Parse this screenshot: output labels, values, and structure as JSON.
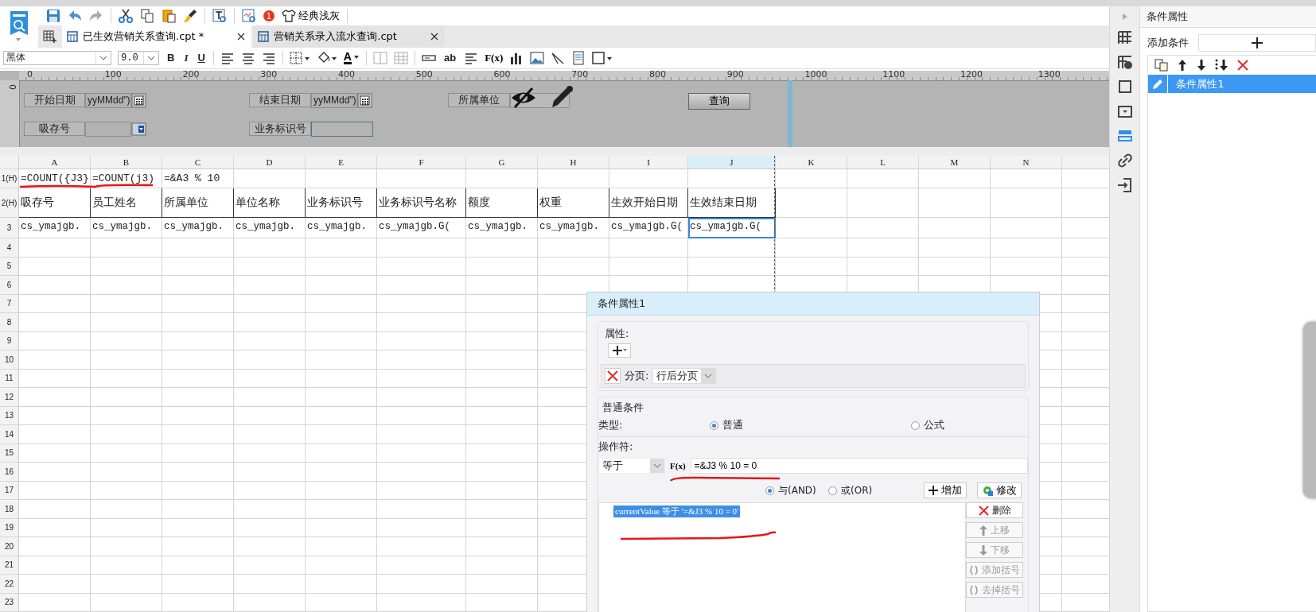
{
  "toolbar": {
    "notification_count": "1",
    "theme_label": "经典浅灰"
  },
  "tabs": [
    {
      "label": "已生效营销关系查询.cpt *",
      "selected": true
    },
    {
      "label": "营销关系录入流水查询.cpt",
      "selected": false
    }
  ],
  "format_bar": {
    "font": "黑体",
    "font_size": "9.0",
    "style_buttons": [
      "B",
      "I",
      "U"
    ],
    "font_color_button": "A",
    "text_button": "ab",
    "formula_button": "F(x)"
  },
  "ruler": {
    "marks": [
      "0",
      "100",
      "200",
      "300",
      "400",
      "500",
      "600",
      "700",
      "800",
      "900",
      "1000",
      "1100",
      "1200",
      "1300"
    ],
    "vertical_mark": "0"
  },
  "parameter_form": {
    "widgets": [
      {
        "kind": "label",
        "text": "开始日期"
      },
      {
        "kind": "date",
        "value": "yyMMdd\")"
      },
      {
        "kind": "label",
        "text": "结束日期"
      },
      {
        "kind": "date",
        "value": "yyMMdd\")"
      },
      {
        "kind": "label",
        "text": "所属单位"
      },
      {
        "kind": "combo",
        "hidden": true
      },
      {
        "kind": "button",
        "text": "查询"
      },
      {
        "kind": "label",
        "text": "吸存号"
      },
      {
        "kind": "combo",
        "hidden": false
      },
      {
        "kind": "label",
        "text": "业务标识号"
      },
      {
        "kind": "text"
      }
    ]
  },
  "sheet": {
    "columns": [
      {
        "label": "A",
        "selected": false
      },
      {
        "label": "B",
        "selected": false
      },
      {
        "label": "C",
        "selected": false
      },
      {
        "label": "D",
        "selected": false
      },
      {
        "label": "E",
        "selected": false
      },
      {
        "label": "F",
        "selected": false
      },
      {
        "label": "G",
        "selected": false
      },
      {
        "label": "H",
        "selected": false
      },
      {
        "label": "I",
        "selected": false
      },
      {
        "label": "J",
        "selected": true
      },
      {
        "label": "K",
        "selected": false
      },
      {
        "label": "L",
        "selected": false
      },
      {
        "label": "M",
        "selected": false
      },
      {
        "label": "N",
        "selected": false
      }
    ],
    "rows": [
      {
        "header": "1(H)",
        "cells": [
          {
            "text": "=COUNT({J3}",
            "selected": false
          },
          {
            "text": "=COUNT(j3)",
            "selected": false
          },
          {
            "text": "=&A3 % 10",
            "selected": false
          }
        ]
      },
      {
        "header": "2(H)",
        "cells": [
          {
            "text": "吸存号",
            "selected": false
          },
          {
            "text": "员工姓名",
            "selected": false
          },
          {
            "text": "所属单位",
            "selected": false
          },
          {
            "text": "单位名称",
            "selected": false
          },
          {
            "text": "业务标识号",
            "selected": false
          },
          {
            "text": "业务标识号名称",
            "selected": false
          },
          {
            "text": "额度",
            "selected": false
          },
          {
            "text": "权重",
            "selected": false
          },
          {
            "text": "生效开始日期",
            "selected": false
          },
          {
            "text": "生效结束日期",
            "selected": false
          }
        ]
      },
      {
        "header": "3",
        "cells": [
          {
            "text": "cs_ymajgb.",
            "selected": false
          },
          {
            "text": "cs_ymajgb.",
            "selected": false
          },
          {
            "text": "cs_ymajgb.",
            "selected": false
          },
          {
            "text": "cs_ymajgb.",
            "selected": false
          },
          {
            "text": "cs_ymajgb.",
            "selected": false
          },
          {
            "text": "cs_ymajgb.G(",
            "selected": false
          },
          {
            "text": "cs_ymajgb.",
            "selected": false
          },
          {
            "text": "cs_ymajgb.",
            "selected": false
          },
          {
            "text": "cs_ymajgb.G(",
            "selected": false
          },
          {
            "text": "cs_ymajgb.G(",
            "selected": true
          }
        ]
      },
      {
        "header": "4"
      },
      {
        "header": "5"
      },
      {
        "header": "6"
      },
      {
        "header": "7"
      },
      {
        "header": "8"
      },
      {
        "header": "9"
      },
      {
        "header": "10"
      },
      {
        "header": "11"
      },
      {
        "header": "12"
      },
      {
        "header": "13"
      },
      {
        "header": "14"
      },
      {
        "header": "15"
      },
      {
        "header": "16"
      },
      {
        "header": "17"
      },
      {
        "header": "18"
      },
      {
        "header": "19"
      },
      {
        "header": "20"
      },
      {
        "header": "21"
      },
      {
        "header": "22"
      },
      {
        "header": "23"
      }
    ]
  },
  "dialog": {
    "title": "条件属性1",
    "attributes_legend": "属性:",
    "page_label": "分页:",
    "page_value": "行后分页",
    "condition_legend": "普通条件",
    "type_label": "类型:",
    "type_options": [
      {
        "label": "普通",
        "selected": true
      },
      {
        "label": "公式",
        "selected": false
      }
    ],
    "operator_label": "操作符:",
    "operator": "等于",
    "formula_button": "F(x)",
    "formula": "=&J3 % 10 = 0",
    "logic_options": [
      {
        "label": "与(AND)",
        "selected": true
      },
      {
        "label": "或(OR)",
        "selected": false
      }
    ],
    "add_button": "增加",
    "modify_button": "修改",
    "conditions": [
      {
        "text": "currentValue 等于 '=&J3 % 10 = 0'",
        "selected": true
      }
    ],
    "side_buttons": [
      {
        "kind": "delete",
        "label": "删除",
        "disabled": false
      },
      {
        "kind": "up",
        "label": "上移",
        "disabled": true
      },
      {
        "kind": "down",
        "label": "下移",
        "disabled": true
      },
      {
        "kind": "add_bracket",
        "label": "添加括号",
        "disabled": true
      },
      {
        "kind": "remove_bracket",
        "label": "去掉括号",
        "disabled": true
      }
    ]
  },
  "right_panel": {
    "title": "条件属性",
    "add_label": "添加条件",
    "items": [
      {
        "label": "条件属性1",
        "selected": true
      }
    ]
  }
}
